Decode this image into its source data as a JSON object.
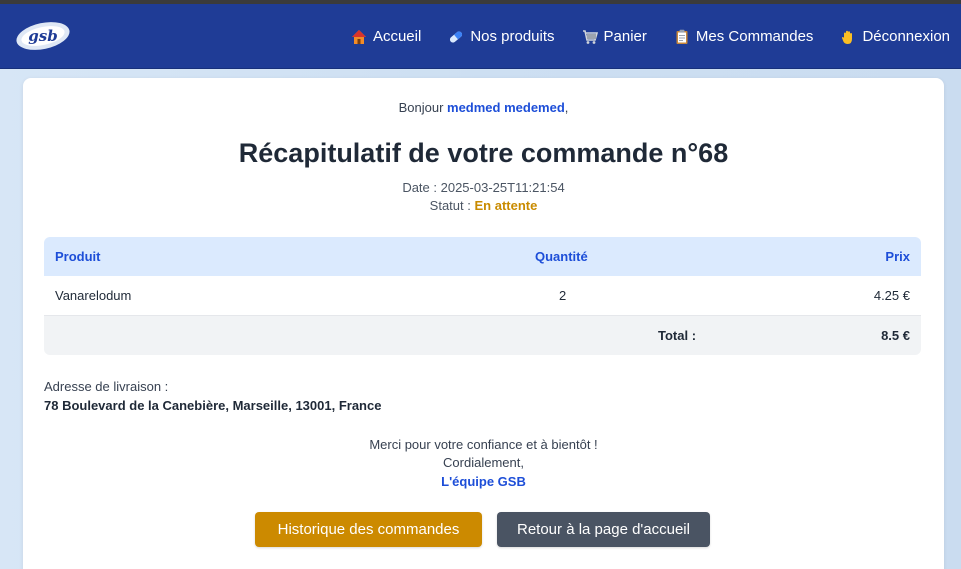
{
  "nav": {
    "logo_text": "gsb",
    "items": [
      {
        "label": "Accueil",
        "icon": "house-icon"
      },
      {
        "label": "Nos produits",
        "icon": "pill-icon"
      },
      {
        "label": "Panier",
        "icon": "cart-icon"
      },
      {
        "label": "Mes Commandes",
        "icon": "clipboard-icon"
      },
      {
        "label": "Déconnexion",
        "icon": "waving-hand-icon"
      }
    ]
  },
  "greeting": {
    "prefix": "Bonjour ",
    "name": "medmed medemed",
    "suffix": ","
  },
  "order": {
    "title": "Récapitulatif de votre commande n°68",
    "date_label": "Date : ",
    "date": "2025-03-25T11:21:54",
    "status_label": "Statut : ",
    "status": "En attente"
  },
  "table": {
    "headers": {
      "product": "Produit",
      "quantity": "Quantité",
      "price": "Prix"
    },
    "rows": [
      {
        "product": "Vanarelodum",
        "quantity": "2",
        "price": "4.25 €"
      }
    ],
    "total_label": "Total :",
    "total_value": "8.5 €"
  },
  "delivery": {
    "label": "Adresse de livraison :",
    "address": "78 Boulevard de la Canebière, Marseille, 13001, France"
  },
  "closing": {
    "line1": "Merci pour votre confiance et à bientôt !",
    "line2": "Cordialement,",
    "line3": "L'équipe GSB"
  },
  "buttons": {
    "history": "Historique des commandes",
    "home": "Retour à la page d'accueil"
  },
  "colors": {
    "navbar": "#1f3c96",
    "accent_blue": "#1d4ed8",
    "status_pending": "#c98b00",
    "history_button": "#cc8a00",
    "home_button": "#4a5463"
  }
}
